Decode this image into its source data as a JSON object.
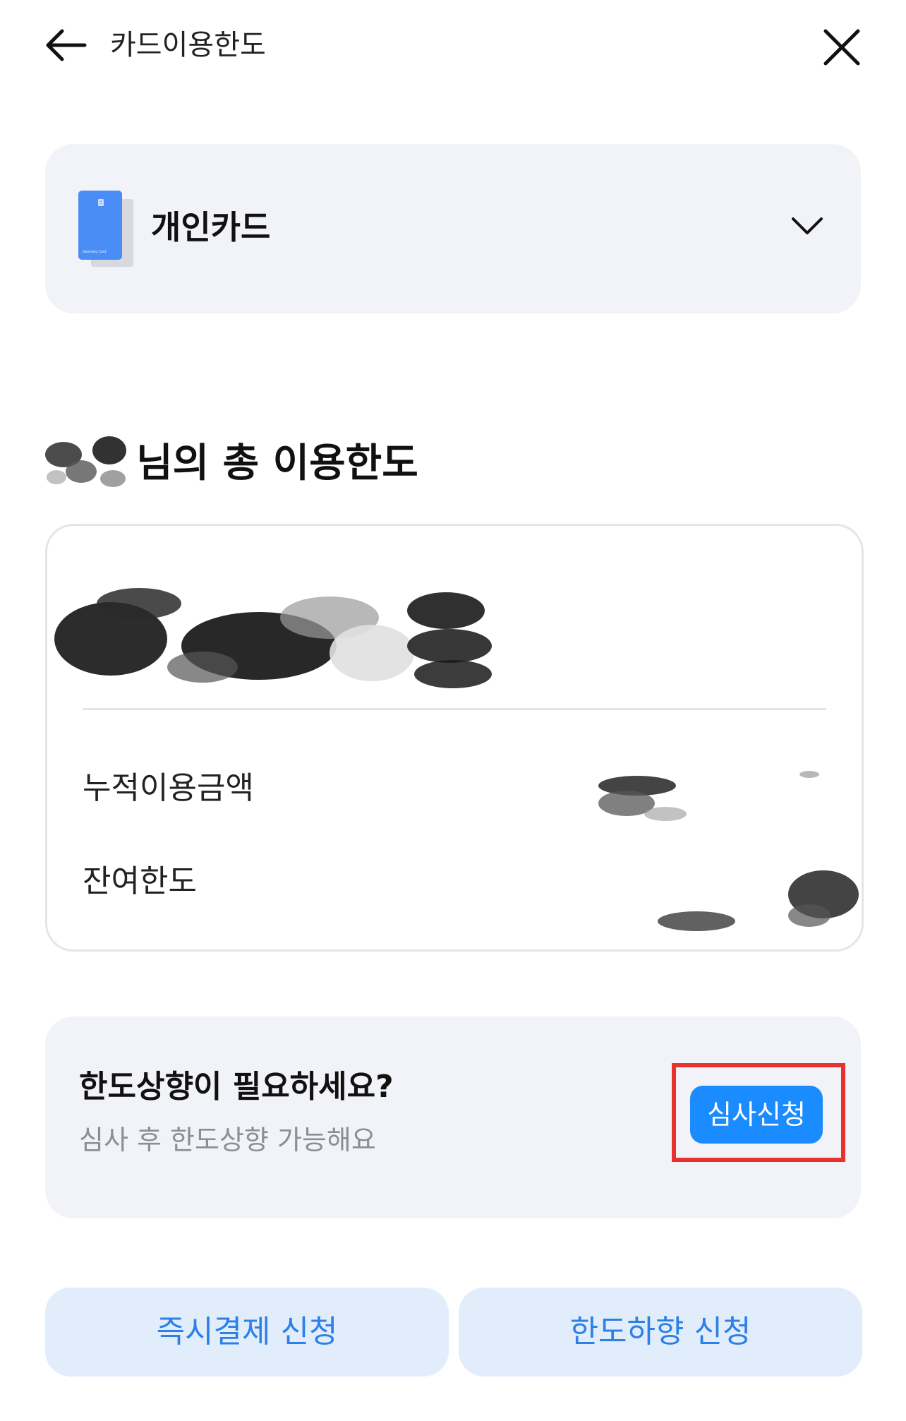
{
  "header": {
    "title": "카드이용한도",
    "back_icon": "arrow-left-icon",
    "close_icon": "close-icon"
  },
  "card_selector": {
    "card_name": "개인카드",
    "card_chip_text": "Samsung Card",
    "card_color": "#4a8df6",
    "dropdown_icon": "chevron-down-icon"
  },
  "limit_section": {
    "title_suffix": "님의 총 이용한도",
    "rows": [
      {
        "label": "누적이용금액"
      },
      {
        "label": "잔여한도"
      }
    ]
  },
  "increase": {
    "title": "한도상향이 필요하세요?",
    "subtitle": "심사 후 한도상향 가능해요",
    "button_label": "심사신청",
    "button_color": "#1a8cff",
    "highlight_color": "#e8322f"
  },
  "bottom_buttons": {
    "left_label": "즉시결제 신청",
    "right_label": "한도하향 신청",
    "text_color": "#2c80e6",
    "background": "#e2edfc"
  }
}
